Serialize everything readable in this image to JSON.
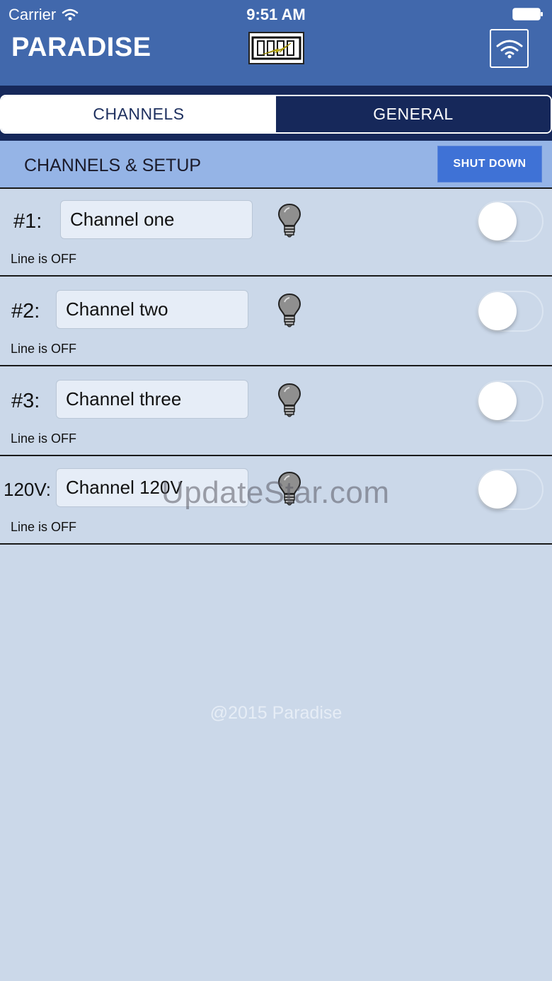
{
  "status_bar": {
    "carrier": "Carrier",
    "time": "9:51 AM"
  },
  "header": {
    "title": "PARADISE"
  },
  "tabs": [
    {
      "label": "CHANNELS",
      "active": true
    },
    {
      "label": "GENERAL",
      "active": false
    }
  ],
  "section": {
    "title": "CHANNELS & SETUP",
    "shutdown_label": "SHUT DOWN"
  },
  "channels": [
    {
      "number": "#1:",
      "name": "Channel one",
      "status": "Line is OFF",
      "on": false
    },
    {
      "number": "#2:",
      "name": "Channel two",
      "status": "Line is OFF",
      "on": false
    },
    {
      "number": "#3:",
      "name": "Channel three",
      "status": "Line is OFF",
      "on": false
    },
    {
      "number": "120V:",
      "name": "Channel 120V",
      "status": "Line is OFF",
      "on": false
    }
  ],
  "footer": {
    "copyright": "@2015 Paradise"
  },
  "watermark": "UpdateStar.com",
  "colors": {
    "header_bg": "#4168ac",
    "tab_dark": "#16285a",
    "section_bg": "#95b4e6",
    "shutdown_bg": "#3f72d6",
    "page_bg": "#cbd8e9"
  },
  "icons": [
    "wifi-icon",
    "battery-icon",
    "logo-icon",
    "bulb-icon"
  ]
}
